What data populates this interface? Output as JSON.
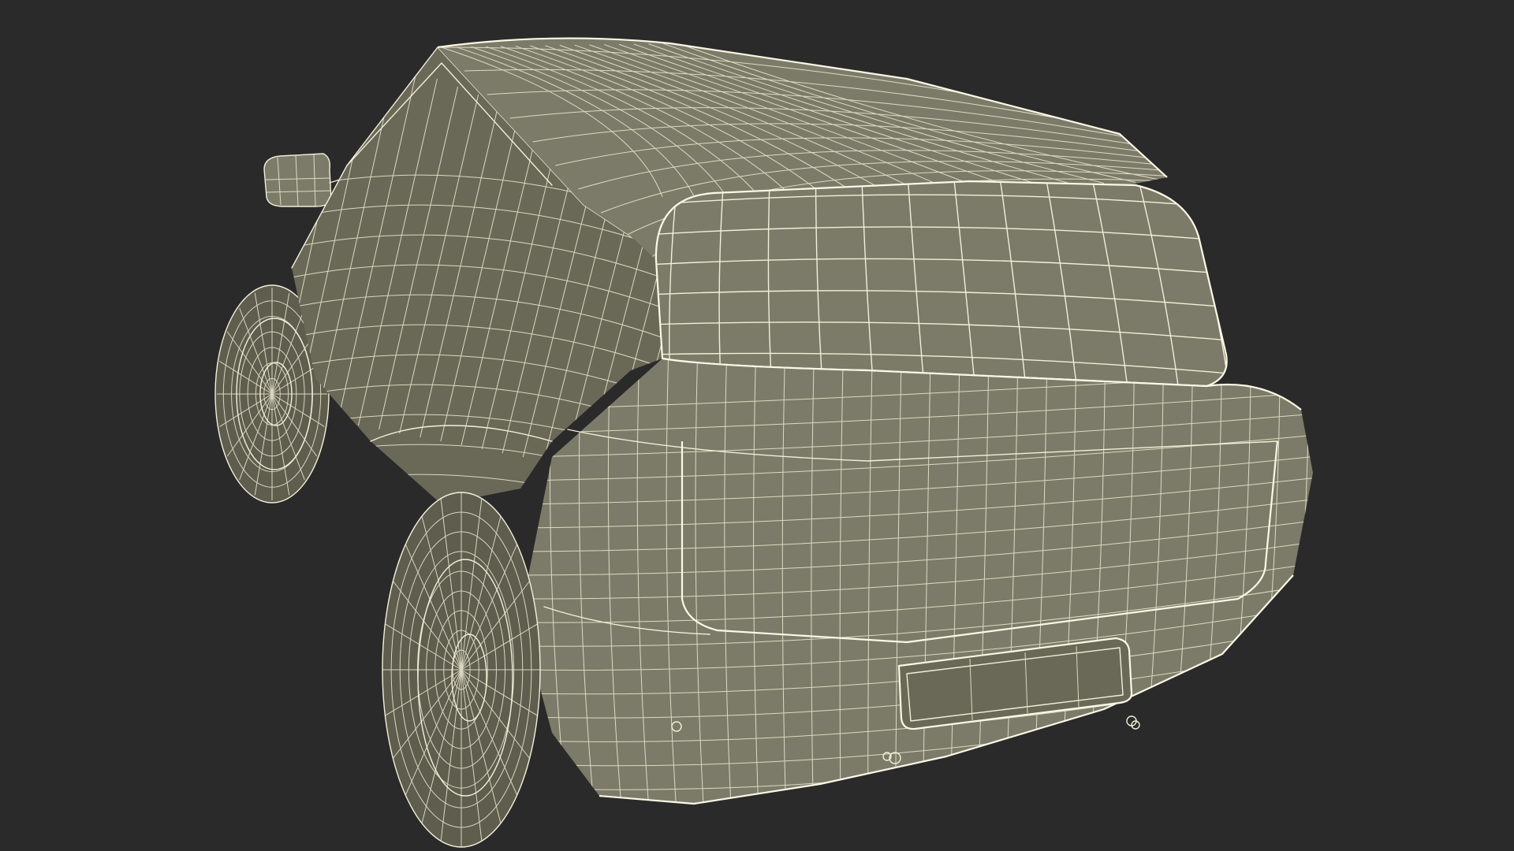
{
  "scene": {
    "background_color": "#2a2a2a",
    "surface_color": "#7c7b69",
    "wire_color": "#f2efd9",
    "subject": "car-wireframe-rear-view"
  }
}
